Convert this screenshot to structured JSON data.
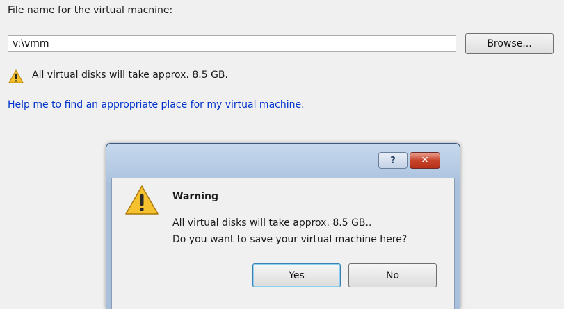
{
  "form": {
    "file_label": "File name for the virtual macnine:",
    "path_value": "v:\\vmm",
    "browse_label": "Browse...",
    "size_notice": "All virtual disks will take approx. 8.5 GB.",
    "help_link": "Help me to find an appropriate place for my virtual machine."
  },
  "dialog": {
    "help_glyph": "?",
    "close_glyph": "✕",
    "heading": "Warning",
    "message_line1": "All virtual disks will take approx. 8.5 GB..",
    "message_line2": "Do you want to save your virtual machine here?",
    "yes_label": "Yes",
    "no_label": "No"
  },
  "colors": {
    "link": "#0033cc",
    "warning_yellow": "#f2c02b",
    "close_red": "#c8442b"
  },
  "icons": [
    "warning-icon",
    "help-icon",
    "close-icon"
  ]
}
